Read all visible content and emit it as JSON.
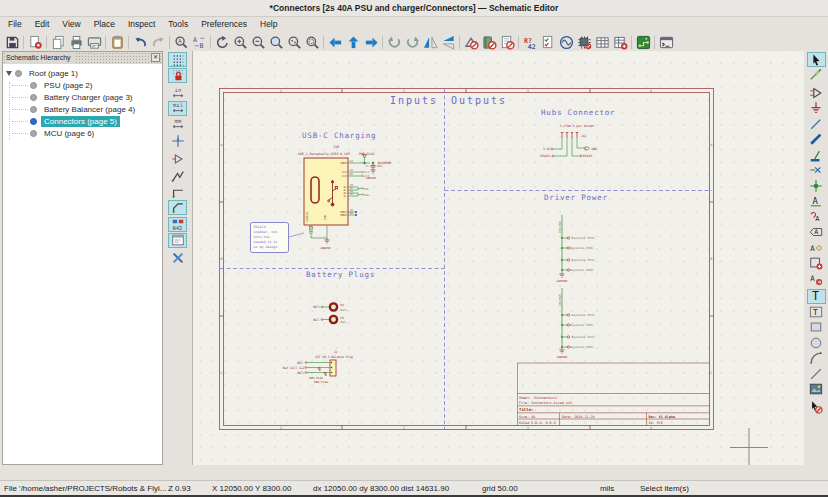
{
  "window": {
    "title": "*Connectors [2s 40A PSU and charger/Connectors] — Schematic Editor"
  },
  "menu": {
    "items": [
      "File",
      "Edit",
      "View",
      "Place",
      "Inspect",
      "Tools",
      "Preferences",
      "Help"
    ]
  },
  "main_toolbar": {
    "groups": [
      [
        "save"
      ],
      [
        "sheet-setup"
      ],
      [
        "new-sheet",
        "print",
        "plot"
      ],
      [
        "paste"
      ],
      [
        "undo",
        "redo"
      ],
      [
        "find",
        "find-replace"
      ],
      [
        "refresh",
        "zoom-in",
        "zoom-out",
        "zoom-fit",
        "zoom-objects",
        "zoom-selection"
      ],
      [
        "nav-left",
        "nav-up",
        "nav-right"
      ],
      [
        "rotate-ccw",
        "rotate-cw",
        "mirror-h",
        "mirror-v"
      ],
      [
        "edit-symbol",
        "edit-library",
        "edit-fields"
      ],
      [
        "annotate",
        "erc",
        "simulator",
        "assign-footprints",
        "edit-table",
        "bom"
      ],
      [
        "open-pcb"
      ],
      [
        "console"
      ]
    ]
  },
  "left_toolbar": {
    "items": [
      {
        "icon": "grid-dots",
        "selected": true
      },
      {
        "icon": "grid-lock",
        "selected": true
      },
      {
        "icon": "unit-in",
        "gap": true
      },
      {
        "icon": "unit-mil",
        "selected": true
      },
      {
        "icon": "unit-mm"
      },
      {
        "icon": "cursor-cross",
        "gap": true
      },
      {
        "icon": "hidden-pins",
        "gap": true
      },
      {
        "icon": "free-angle",
        "gap": true
      },
      {
        "icon": "hv-lines"
      },
      {
        "icon": "line-45",
        "selected": true
      },
      {
        "icon": "anno-auto",
        "selected": true,
        "gap": true
      },
      {
        "icon": "props-dialog",
        "selected": true
      },
      {
        "icon": "tools-x",
        "gap": true
      }
    ]
  },
  "right_toolbar": {
    "items": [
      {
        "icon": "cursor-arrow",
        "selected": true
      },
      {
        "icon": "highlight-net"
      },
      {
        "icon": "add-symbol",
        "gap": true
      },
      {
        "icon": "add-power"
      },
      {
        "icon": "add-wire"
      },
      {
        "icon": "add-bus"
      },
      {
        "icon": "bus-entry"
      },
      {
        "icon": "no-connect"
      },
      {
        "icon": "junction"
      },
      {
        "icon": "net-label"
      },
      {
        "icon": "net-class"
      },
      {
        "icon": "global-label"
      },
      {
        "icon": "hier-label"
      },
      {
        "icon": "hier-sheet"
      },
      {
        "icon": "sheet-pin"
      },
      {
        "icon": "add-text",
        "selected": true,
        "gap": true
      },
      {
        "icon": "add-textbox"
      },
      {
        "icon": "add-rect"
      },
      {
        "icon": "add-circle"
      },
      {
        "icon": "add-arc"
      },
      {
        "icon": "add-line"
      },
      {
        "icon": "add-image"
      },
      {
        "icon": "delete-tool",
        "gap": true
      }
    ]
  },
  "hierarchy": {
    "header": "Schematic Hierarchy",
    "items": [
      {
        "label": "Root (page 1)",
        "level": 0,
        "selected": false,
        "expander": true
      },
      {
        "label": "PSU (page 2)",
        "level": 1,
        "selected": false
      },
      {
        "label": "Battery Charger (page 3)",
        "level": 1,
        "selected": false
      },
      {
        "label": "Battery Balancer (page 4)",
        "level": 1,
        "selected": false
      },
      {
        "label": "Connectors (page 5)",
        "level": 1,
        "selected": true
      },
      {
        "label": "MCU (page 6)",
        "level": 1,
        "selected": false
      }
    ]
  },
  "canvas": {
    "frame": {
      "cols": [
        "1",
        "2",
        "3",
        "4"
      ],
      "rows": [
        "A",
        "B",
        "C"
      ]
    },
    "sections": {
      "inputs": "Inputs",
      "outputs": "Outputs",
      "usbc": "USB-C Charging",
      "hubs": "Hubs Connector",
      "driver": "Driver Power",
      "battery": "Battery Plugs"
    },
    "usbc": {
      "ref": "J10",
      "value": "USB_C_Receptacle_USB2.0_16P",
      "pwr_flag": "PWR_FLAG",
      "pins": {
        "vbus": "VBUS",
        "cc1": "CC1",
        "cc2": "CC2",
        "dp1": "D+",
        "dm1": "D-",
        "dp2": "D+",
        "dm2": "D-",
        "sbu1": "SBU1",
        "sbu2": "SBU2",
        "shield": "SHIELD",
        "gnd": "GND"
      },
      "pin_nums": [
        "A4",
        "A5",
        "B5",
        "A6",
        "A7",
        "B6",
        "B7",
        "A8",
        "B8"
      ],
      "nets": {
        "usbpwr": "USBPWR",
        "gndpwr": "GNDPWR",
        "d_minus": "D0-",
        "d_plus": "D0+",
        "cc1": "CC1",
        "cc2": "CC2"
      },
      "cap_ref": "C1",
      "cap_val": "100n",
      "note_lines": [
        "Shield",
        "snubber, not",
        "sure how",
        "needed it is",
        "on my design"
      ],
      "gnd2": "GNDPWR"
    },
    "hubs": {
      "note": "1.27mm 4 pin socket",
      "ref": "J11",
      "v33": "3.3V",
      "gnd": "GND",
      "rs_p": "RS485+",
      "rs_m": "RS485-"
    },
    "driver": {
      "terminal_a": "Keystone 3570",
      "terminal_b": "Keystone 3569",
      "gnd": "GNDPWR",
      "net1": "DRV1PWR",
      "net2": "DRV2PWR"
    },
    "battery": {
      "h1_ref": "H1",
      "h1_val": "Bat+",
      "h2_ref": "H2",
      "h2_val": "Bat-",
      "bat_p": "BAT+",
      "bat_m": "BAT-",
      "j2_ref": "J2",
      "j2_val": "JST XH-3 Balance Plug",
      "cell": "Bat Cell 1&2",
      "pwr_flag": "PWR_FLAG"
    },
    "title_block": {
      "sheet": "Sheet: /Connectors/",
      "file": "File: Connectors.kicad_sch",
      "title": "Title:",
      "size": "Size: A4",
      "date": "Date: 2024-11-28",
      "rev": "Rev: V1 Alpha",
      "kicad": "KiCad E.D.A. 8.0.6",
      "id": "Id: 5/6"
    }
  },
  "status_bar": {
    "file": "File '/home/asher/PROJECTS/Robots & Flyi...",
    "zoom": "Z 0.93",
    "xy": "X 12050.00 Y 8300.00",
    "dxy": "dx 12050.00 dy 8300.00 dist 14631.90",
    "grid": "grid 50.00",
    "units": "mils",
    "action": "Select item(s)"
  }
}
